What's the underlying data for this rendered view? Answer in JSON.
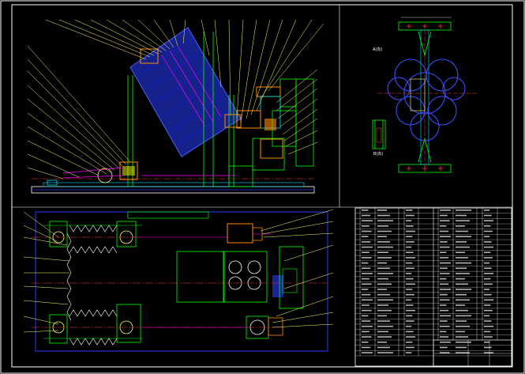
{
  "window": {
    "title": ""
  },
  "views": {
    "detail_view_a_label": "A(向)",
    "detail_view_b_label": "B(向)"
  },
  "colors": {
    "background": "#000000",
    "frame": "#ffffff",
    "structure": "#00ff00",
    "leaders": "#ffff66",
    "centerlines": "#ff3030",
    "machine_body": "#2a3cff",
    "hatch": "#ff00ff",
    "parts_cyan": "#00e0ff",
    "parts_orange": "#ff8c00"
  },
  "title_block": {
    "part_rows": 28
  }
}
